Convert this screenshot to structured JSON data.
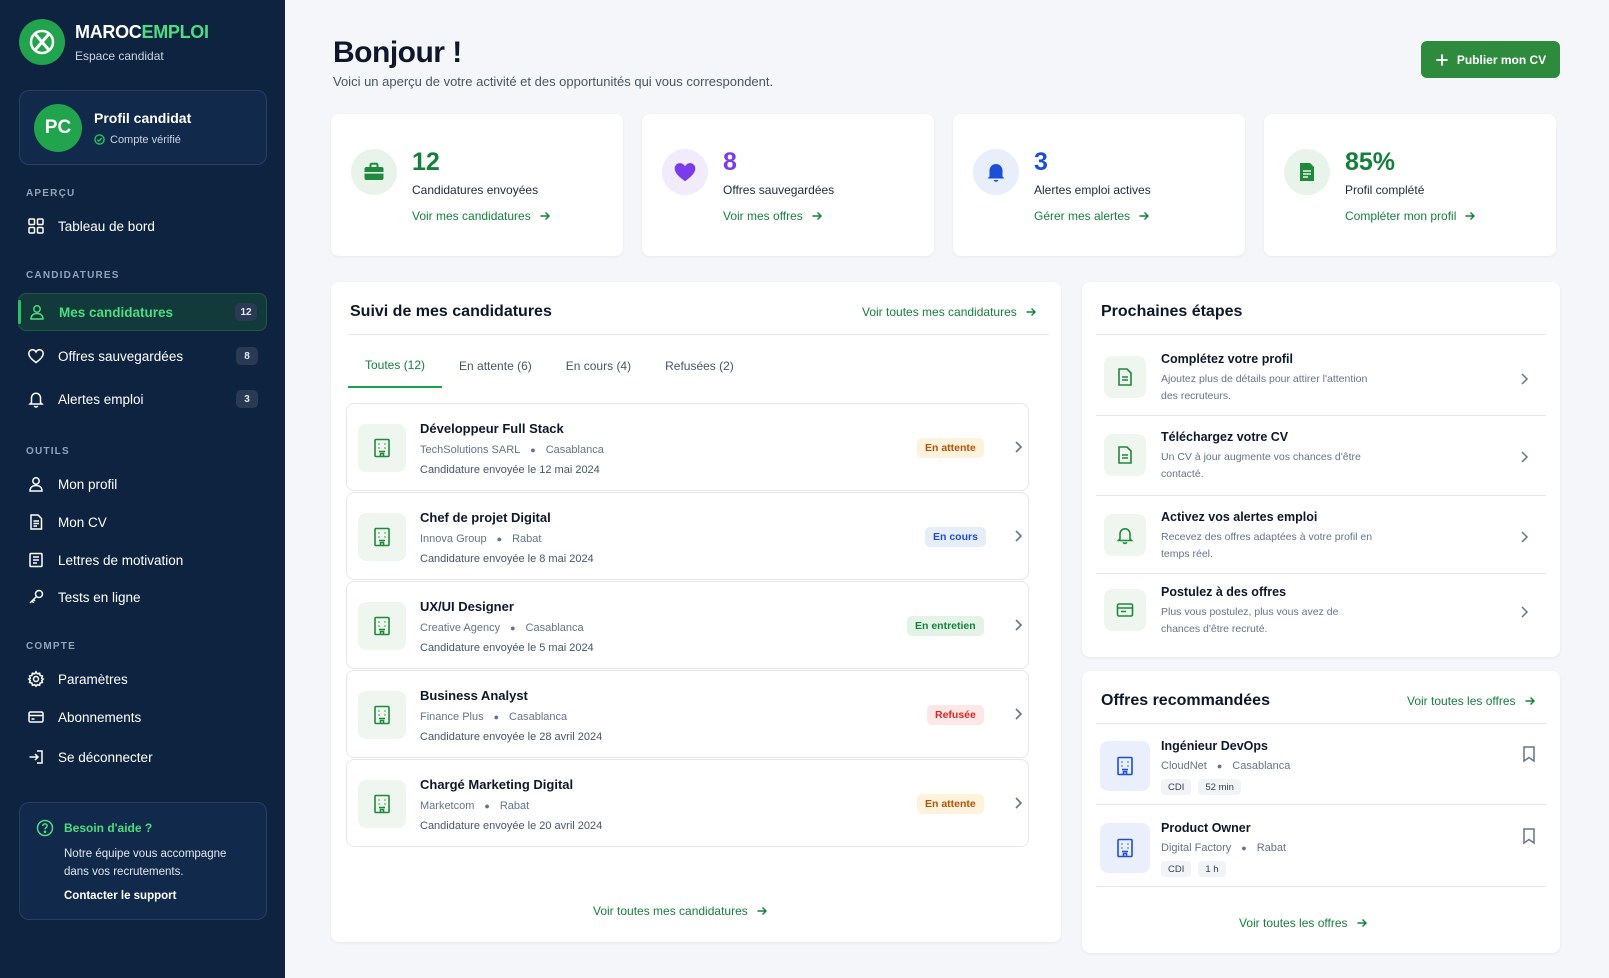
{
  "brand": {
    "name_part1": "MAROC",
    "name_part2": "EMPLOI",
    "subtitle": "Espace candidat"
  },
  "profile": {
    "initials": "PC",
    "name": "Profil candidat",
    "status": "Compte vérifié"
  },
  "sidebar": {
    "sections": {
      "apercu": "APERÇU",
      "candidatures": "CANDIDATURES",
      "outils": "OUTILS",
      "compte": "COMPTE"
    },
    "items": {
      "tableau": "Tableau de bord",
      "candidatures": "Mes candidatures",
      "candidatures_count": "12",
      "offres": "Offres sauvegardées",
      "offres_count": "8",
      "alertes": "Alertes emploi",
      "alertes_count": "3",
      "profil": "Mon profil",
      "cv": "Mon CV",
      "lettres": "Lettres de motivation",
      "tests": "Tests en ligne",
      "parametres": "Paramètres",
      "abonnements": "Abonnements",
      "deconnexion": "Se déconnecter"
    },
    "help": {
      "title": "Besoin d'aide ?",
      "text": "Notre équipe vous accompagne dans vos recrutements.",
      "link": "Contacter le support"
    }
  },
  "header": {
    "title": "Bonjour !",
    "subtitle": "Voici un aperçu de votre activité et des opportunités qui vous correspondent.",
    "publish_label": "Publier mon CV"
  },
  "stats": [
    {
      "value": "12",
      "label": "Candidatures envoyées",
      "link": "Voir mes candidatures",
      "color": "#15803d",
      "bg": "#e8f3ea"
    },
    {
      "value": "8",
      "label": "Offres sauvegardées",
      "link": "Voir mes offres",
      "color": "#7c3aed",
      "bg": "#f1ebfb"
    },
    {
      "value": "3",
      "label": "Alertes emploi actives",
      "link": "Gérer mes alertes",
      "color": "#1d4ed8",
      "bg": "#e8effb"
    },
    {
      "value": "85%",
      "label": "Profil complété",
      "link": "Compléter mon profil",
      "color": "#15803d",
      "bg": "#e8f3ea"
    }
  ],
  "applications": {
    "title": "Suivi de mes candidatures",
    "link_top": "Voir toutes mes candidatures",
    "link_bottom": "Voir toutes mes candidatures",
    "tabs": [
      "Toutes (12)",
      "En attente (6)",
      "En cours (4)",
      "Refusées (2)"
    ],
    "rows": [
      {
        "title": "Développeur Full Stack",
        "company": "TechSolutions SARL",
        "city": "Casablanca",
        "date": "Candidature envoyée le 12 mai 2024",
        "status": "En attente",
        "status_color": "#b45309",
        "status_bg": "#fdf3dc"
      },
      {
        "title": "Chef de projet Digital",
        "company": "Innova Group",
        "city": "Rabat",
        "date": "Candidature envoyée le 8 mai 2024",
        "status": "En cours",
        "status_color": "#1d4ed8",
        "status_bg": "#e6eefc"
      },
      {
        "title": "UX/UI Designer",
        "company": "Creative Agency",
        "city": "Casablanca",
        "date": "Candidature envoyée le 5 mai 2024",
        "status": "En entretien",
        "status_color": "#15803d",
        "status_bg": "#e3f4e7"
      },
      {
        "title": "Business Analyst",
        "company": "Finance Plus",
        "city": "Casablanca",
        "date": "Candidature envoyée le 28 avril 2024",
        "status": "Refusée",
        "status_color": "#dc2626",
        "status_bg": "#fde7e7"
      },
      {
        "title": "Chargé Marketing Digital",
        "company": "Marketcom",
        "city": "Rabat",
        "date": "Candidature envoyée le 20 avril 2024",
        "status": "En attente",
        "status_color": "#b45309",
        "status_bg": "#fdf3dc"
      }
    ]
  },
  "next_steps": {
    "title": "Prochaines étapes",
    "items": [
      {
        "title": "Complétez votre profil",
        "desc": "Ajoutez plus de détails pour attirer l'attention des recruteurs."
      },
      {
        "title": "Téléchargez votre CV",
        "desc": "Un CV à jour augmente vos chances d'être contacté."
      },
      {
        "title": "Activez vos alertes emploi",
        "desc": "Recevez des offres adaptées à votre profil en temps réel."
      },
      {
        "title": "Postulez à des offres",
        "desc": "Plus vous postulez, plus vous avez de chances d'être recruté."
      }
    ]
  },
  "recommended": {
    "title": "Offres recommandées",
    "link_top": "Voir toutes les offres",
    "link_bottom": "Voir toutes les offres",
    "items": [
      {
        "title": "Ingénieur DevOps",
        "company": "CloudNet",
        "city": "Casablanca",
        "contract": "CDI",
        "time": "52 min"
      },
      {
        "title": "Product Owner",
        "company": "Digital Factory",
        "city": "Rabat",
        "contract": "CDI",
        "time": "1 h"
      }
    ]
  }
}
